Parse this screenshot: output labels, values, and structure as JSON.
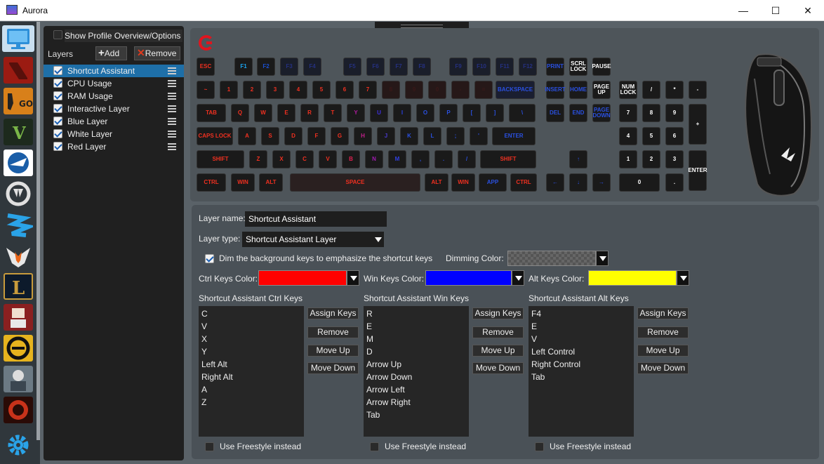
{
  "window": {
    "title": "Aurora",
    "controls": [
      "—",
      "☐",
      "✕"
    ]
  },
  "sidebar": {
    "items": [
      "desktop",
      "dota2",
      "csgo",
      "gta-v",
      "rocket-league",
      "overwatch",
      "payday2",
      "the-division",
      "league-of-legends",
      "hotline-miami",
      "blacklight",
      "battlefield",
      "killing-floor",
      "settings"
    ]
  },
  "layers_panel": {
    "overview_label": "Show Profile Overview/Options",
    "layers_label": "Layers",
    "add_label": "Add",
    "remove_label": "Remove",
    "layers": [
      {
        "name": "Shortcut Assistant",
        "checked": true,
        "selected": true
      },
      {
        "name": "CPU Usage",
        "checked": true,
        "selected": false
      },
      {
        "name": "RAM Usage",
        "checked": true,
        "selected": false
      },
      {
        "name": "Interactive Layer",
        "checked": true,
        "selected": false
      },
      {
        "name": "Blue Layer",
        "checked": true,
        "selected": false
      },
      {
        "name": "White Layer",
        "checked": true,
        "selected": false
      },
      {
        "name": "Red Layer",
        "checked": true,
        "selected": false
      }
    ]
  },
  "keyboard": {
    "rows": [
      [
        "ESC",
        "F1",
        "F2",
        "F3",
        "F4",
        "F5",
        "F6",
        "F7",
        "F8",
        "F9",
        "F10",
        "F11",
        "F12",
        "PRINT",
        "SCRL LOCK",
        "PAUSE"
      ],
      [
        "~",
        "1",
        "2",
        "3",
        "4",
        "5",
        "6",
        "7",
        "8",
        "9",
        "0",
        "-",
        "=",
        "BACKSPACE",
        "INSERT",
        "HOME",
        "PAGE UP",
        "NUM LOCK",
        "/",
        "*",
        "-"
      ],
      [
        "TAB",
        "Q",
        "W",
        "E",
        "R",
        "T",
        "Y",
        "U",
        "I",
        "O",
        "P",
        "[",
        "]",
        "\\",
        "DEL",
        "END",
        "PAGE DOWN",
        "7",
        "8",
        "9",
        "+"
      ],
      [
        "CAPS LOCK",
        "A",
        "S",
        "D",
        "F",
        "G",
        "H",
        "J",
        "K",
        "L",
        ";",
        "'",
        "ENTER",
        "4",
        "5",
        "6"
      ],
      [
        "SHIFT",
        "Z",
        "X",
        "C",
        "V",
        "B",
        "N",
        "M",
        ",",
        ".",
        "/",
        "SHIFT",
        "↑",
        "1",
        "2",
        "3",
        "ENTER"
      ],
      [
        "CTRL",
        "WIN",
        "ALT",
        "SPACE",
        "ALT",
        "WIN",
        "APP",
        "CTRL",
        "←",
        "↓",
        "→",
        "0",
        "."
      ]
    ]
  },
  "props": {
    "layer_name_label": "Layer name:",
    "layer_name_value": "Shortcut Assistant",
    "layer_type_label": "Layer type:",
    "layer_type_value": "Shortcut Assistant Layer",
    "dim_label": "Dim the background keys to emphasize the shortcut keys",
    "dim_color_label": "Dimming Color:",
    "ctrl_color_label": "Ctrl Keys Color:",
    "win_color_label": "Win Keys Color:",
    "alt_color_label": "Alt Keys Color:",
    "colors": {
      "ctrl": "#ff0000",
      "win": "#0000ff",
      "alt": "#ffff00"
    },
    "groups": [
      {
        "title": "Shortcut Assistant Ctrl Keys",
        "items": [
          "C",
          "V",
          "X",
          "Y",
          "Left Alt",
          "Right Alt",
          "A",
          "Z"
        ]
      },
      {
        "title": "Shortcut Assistant Win Keys",
        "items": [
          "R",
          "E",
          "M",
          "D",
          "Arrow Up",
          "Arrow Down",
          "Arrow Left",
          "Arrow Right",
          "Tab"
        ]
      },
      {
        "title": "Shortcut Assistant Alt Keys",
        "items": [
          "F4",
          "E",
          "V",
          "Left Control",
          "Right Control",
          "Tab"
        ]
      }
    ],
    "buttons": {
      "assign": "Assign Keys",
      "remove": "Remove",
      "up": "Move Up",
      "down": "Move Down"
    },
    "freestyle_label": "Use Freestyle instead"
  }
}
